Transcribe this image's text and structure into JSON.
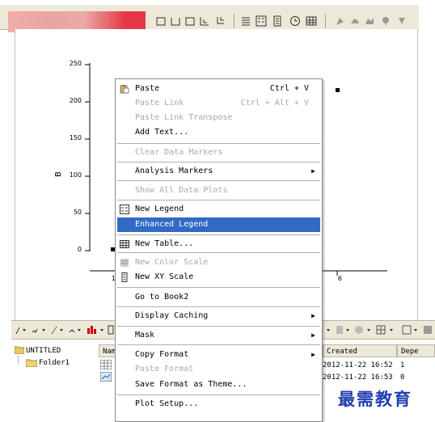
{
  "graph": {
    "y_axis_label": "B",
    "y_ticks": [
      "250",
      "200",
      "150",
      "100",
      "50",
      "0"
    ],
    "x_ticks_visible": [
      "1",
      "6"
    ]
  },
  "context_menu": {
    "items": [
      {
        "label": "Paste",
        "shortcut": "Ctrl + V",
        "enabled": true,
        "icon": "paste-icon"
      },
      {
        "label": "Paste Link",
        "shortcut": "Ctrl + Alt + V",
        "enabled": false
      },
      {
        "label": "Paste Link Transpose",
        "shortcut": "",
        "enabled": false
      },
      {
        "label": "Add Text...",
        "shortcut": "",
        "enabled": true
      },
      {
        "label": "Clear Data Markers",
        "shortcut": "",
        "enabled": false
      },
      {
        "label": "Analysis Markers",
        "shortcut": "",
        "enabled": true,
        "submenu": true
      },
      {
        "label": "Show All Data Plots",
        "shortcut": "",
        "enabled": false
      },
      {
        "label": "New Legend",
        "shortcut": "",
        "enabled": true,
        "icon": "legend-icon"
      },
      {
        "label": "Enhanced Legend",
        "shortcut": "",
        "enabled": true,
        "selected": true
      },
      {
        "label": "New Table...",
        "shortcut": "",
        "enabled": true,
        "icon": "table-icon"
      },
      {
        "label": "New Color Scale",
        "shortcut": "",
        "enabled": false,
        "icon": "color-scale-icon"
      },
      {
        "label": "New XY Scale",
        "shortcut": "",
        "enabled": true,
        "icon": "xy-scale-icon"
      },
      {
        "label": "Go to Book2",
        "shortcut": "",
        "enabled": true
      },
      {
        "label": "Display Caching",
        "shortcut": "",
        "enabled": true,
        "submenu": true
      },
      {
        "label": "Mask",
        "shortcut": "",
        "enabled": true,
        "submenu": true
      },
      {
        "label": "Copy Format",
        "shortcut": "",
        "enabled": true,
        "submenu": true
      },
      {
        "label": "Paste Format",
        "shortcut": "",
        "enabled": false
      },
      {
        "label": "Save Format as Theme...",
        "shortcut": "",
        "enabled": true
      },
      {
        "label": "Plot Setup...",
        "shortcut": "",
        "enabled": true
      }
    ]
  },
  "explorer": {
    "root": "UNTITLED",
    "folder": "Folder1",
    "columns": {
      "name": "Nam",
      "created": "Created",
      "dependents": "Depe"
    },
    "rows": [
      {
        "created": "2012-11-22 16:52",
        "dependents": "1"
      },
      {
        "created": "2012-11-22 16:53",
        "dependents": "0"
      }
    ]
  },
  "watermark": "最需教育",
  "colors": {
    "menu_highlight": "#316ac5",
    "toolbar_bg": "#ece9d8",
    "watermark": "#1f3fb0"
  }
}
